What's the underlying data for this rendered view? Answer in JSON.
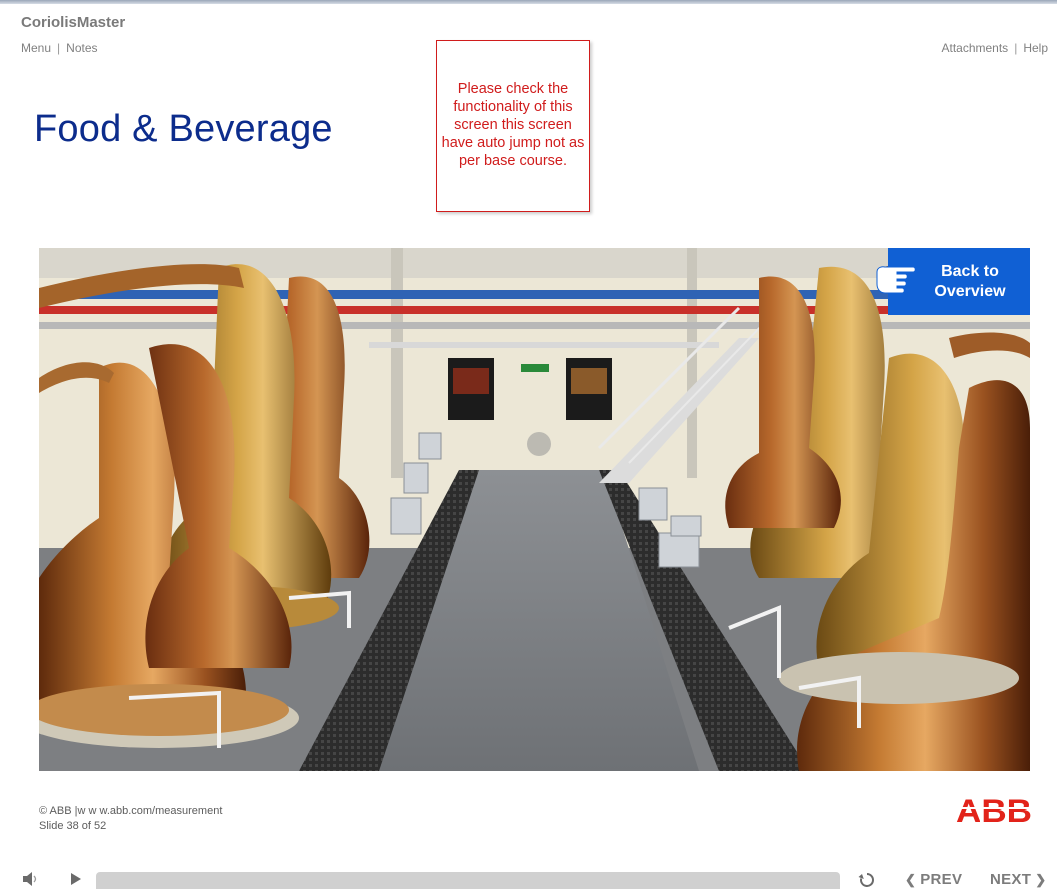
{
  "app": {
    "title": "CoriolisMaster"
  },
  "topnav": {
    "menu": "Menu",
    "notes": "Notes",
    "attachments": "Attachments",
    "help": "Help",
    "separator": "|"
  },
  "slide": {
    "title": "Food & Beverage",
    "review_note": "Please check the functionality of this screen this screen have auto jump not as per base course.",
    "back_button": "Back to\nOverview",
    "copyright": "© ABB |w w w.abb.com/measurement",
    "slide_counter": "Slide 38 of 52",
    "logo_text": "ABB"
  },
  "player": {
    "prev_label": "PREV",
    "next_label": "NEXT",
    "progress_fraction": 0.0
  },
  "colors": {
    "title_blue": "#0c2c8c",
    "note_red": "#d01c1c",
    "button_blue": "#1060d4",
    "abb_red": "#e2231a"
  },
  "icons": [
    "speaker-icon",
    "play-icon",
    "replay-icon",
    "chevron-left-icon",
    "chevron-right-icon",
    "pointing-hand-icon"
  ]
}
